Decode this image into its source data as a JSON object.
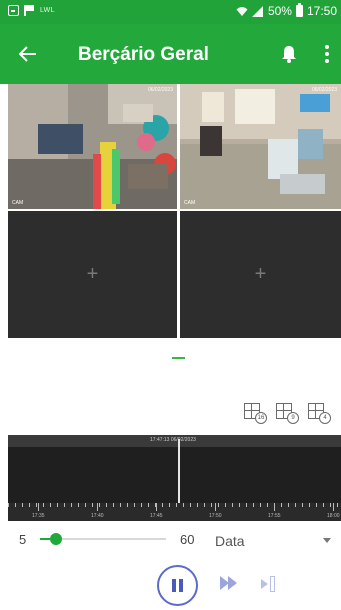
{
  "status_bar": {
    "carrier": "LWL",
    "battery": "50%",
    "time": "17:50"
  },
  "app_bar": {
    "title": "Berçário Geral"
  },
  "cameras": [
    {
      "label": "CAM",
      "timestamp": "06/02/2023"
    },
    {
      "label": "CAM",
      "timestamp": "06/02/2023"
    },
    {
      "add_symbol": "+"
    },
    {
      "add_symbol": "+"
    }
  ],
  "layouts": [
    "16",
    "9",
    "4"
  ],
  "timeline": {
    "timestamp": "17:47:13 06/02/2023",
    "tick_labels": [
      "17:35",
      "17:40",
      "17:45",
      "17:50",
      "17:55",
      "18:00"
    ]
  },
  "speed": {
    "min": "5",
    "max": "60",
    "value_fraction": 0.08
  },
  "date_select": {
    "label": "Data"
  },
  "icons": {
    "back": "arrow-left-icon",
    "bell": "bell-icon",
    "more": "more-vert-icon",
    "pause": "pause-icon",
    "fast_forward": "fast-forward-icon",
    "step": "step-forward-icon"
  },
  "colors": {
    "status_bar": "#22a33a",
    "app_bar": "#23a93b",
    "accent": "#1eaa3a",
    "playback": "#5b6bc7"
  }
}
